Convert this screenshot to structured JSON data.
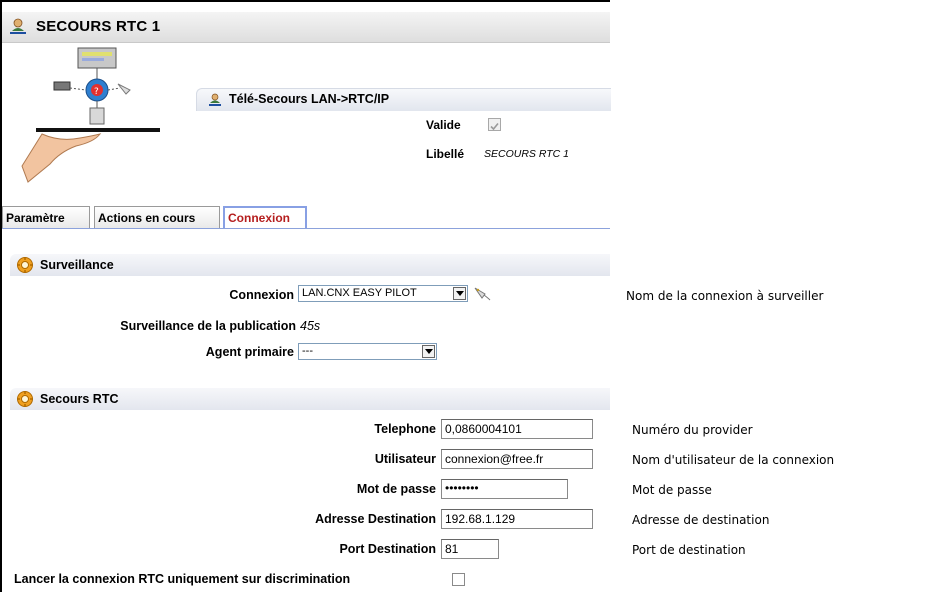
{
  "window": {
    "title": "SECOURS RTC 1"
  },
  "info": {
    "service_label": "Télé-Secours LAN->RTC/IP",
    "valide_label": "Valide",
    "valide_checked": true,
    "libelle_label": "Libellé",
    "libelle_value": "SECOURS RTC 1"
  },
  "tabs": [
    {
      "label": "Paramètre",
      "active": false
    },
    {
      "label": "Actions en cours",
      "active": false
    },
    {
      "label": "Connexion",
      "active": true
    }
  ],
  "surveillance": {
    "title": "Surveillance",
    "connexion_label": "Connexion",
    "connexion_value": "LAN.CNX EASY PILOT",
    "connexion_desc": "Nom de la connexion à surveiller",
    "publication_label": "Surveillance de la publication",
    "publication_value": "45s",
    "agent_label": "Agent primaire",
    "agent_value": "---"
  },
  "secours": {
    "title": "Secours RTC",
    "telephone_label": "Telephone",
    "telephone_value": "0,0860004101",
    "telephone_desc": "Numéro du provider",
    "utilisateur_label": "Utilisateur",
    "utilisateur_value": "connexion@free.fr",
    "utilisateur_desc": "Nom d'utilisateur de la connexion",
    "motdepasse_label": "Mot de passe",
    "motdepasse_value": "••••••••",
    "motdepasse_desc": "Mot de passe",
    "adresse_label": "Adresse Destination",
    "adresse_value": "192.68.1.129",
    "adresse_desc": "Adresse de destination",
    "port_label": "Port Destination",
    "port_value": "81",
    "port_desc": "Port de destination",
    "discrimination_label": "Lancer la connexion RTC uniquement sur discrimination",
    "discrimination_checked": false
  },
  "colors": {
    "active_tab_text": "#b51e1e",
    "tab_accent": "#88a0e4",
    "section_gear": "#f0a020"
  },
  "icons": {
    "title": "network-user-icon",
    "illustration": "network-hand-illustration",
    "section": "gear-icon",
    "connexion_action": "cable-plug-icon"
  }
}
